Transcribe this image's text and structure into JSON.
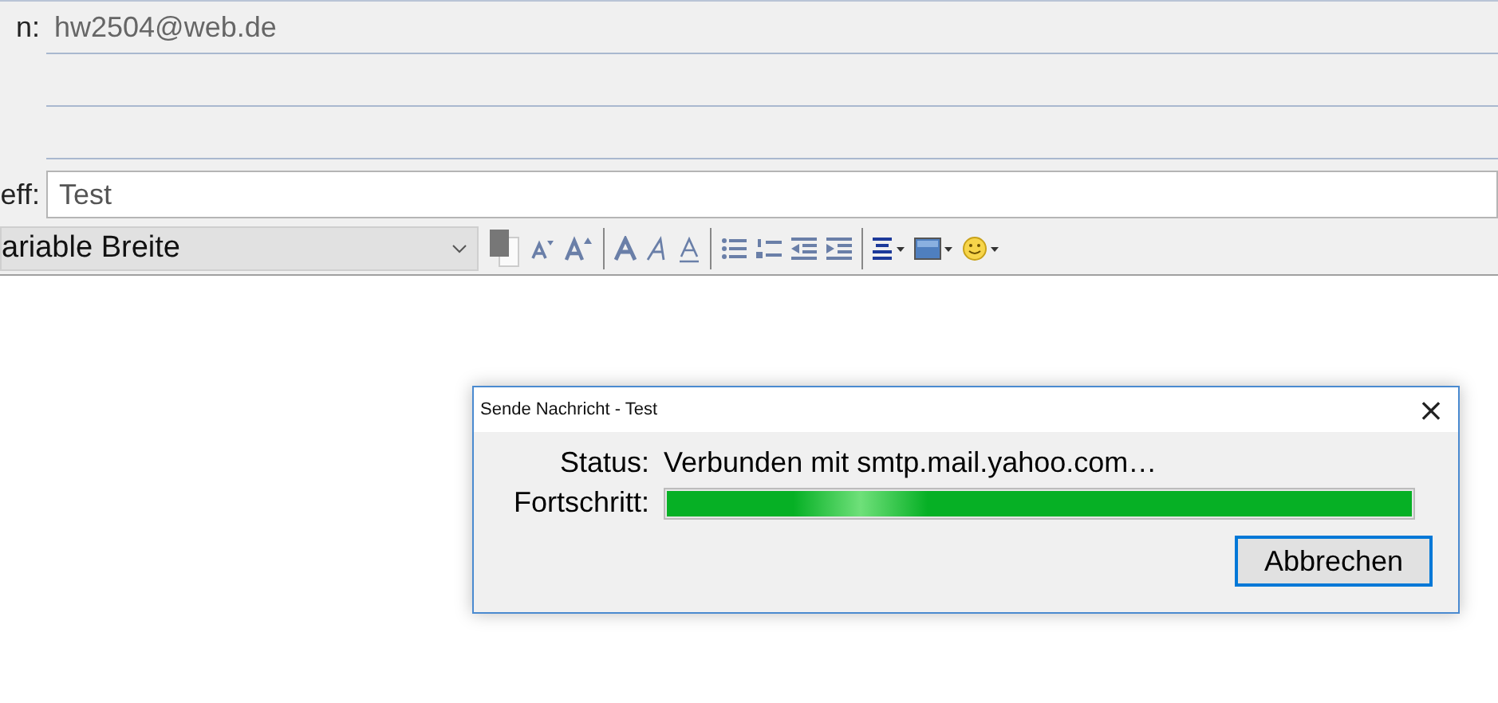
{
  "recipients": [
    {
      "label": "n:",
      "value": "hw2504@web.de"
    }
  ],
  "subject": {
    "label": "eff:",
    "value": "Test"
  },
  "toolbar": {
    "font_select": "ariable Breite"
  },
  "dialog": {
    "title": "Sende Nachricht - Test",
    "close": "×",
    "status_label": "Status:",
    "status": "Verbunden mit smtp.mail.yahoo.com…",
    "progress_label": "Fortschritt:",
    "level": 1,
    "button": "Abbrechen"
  }
}
